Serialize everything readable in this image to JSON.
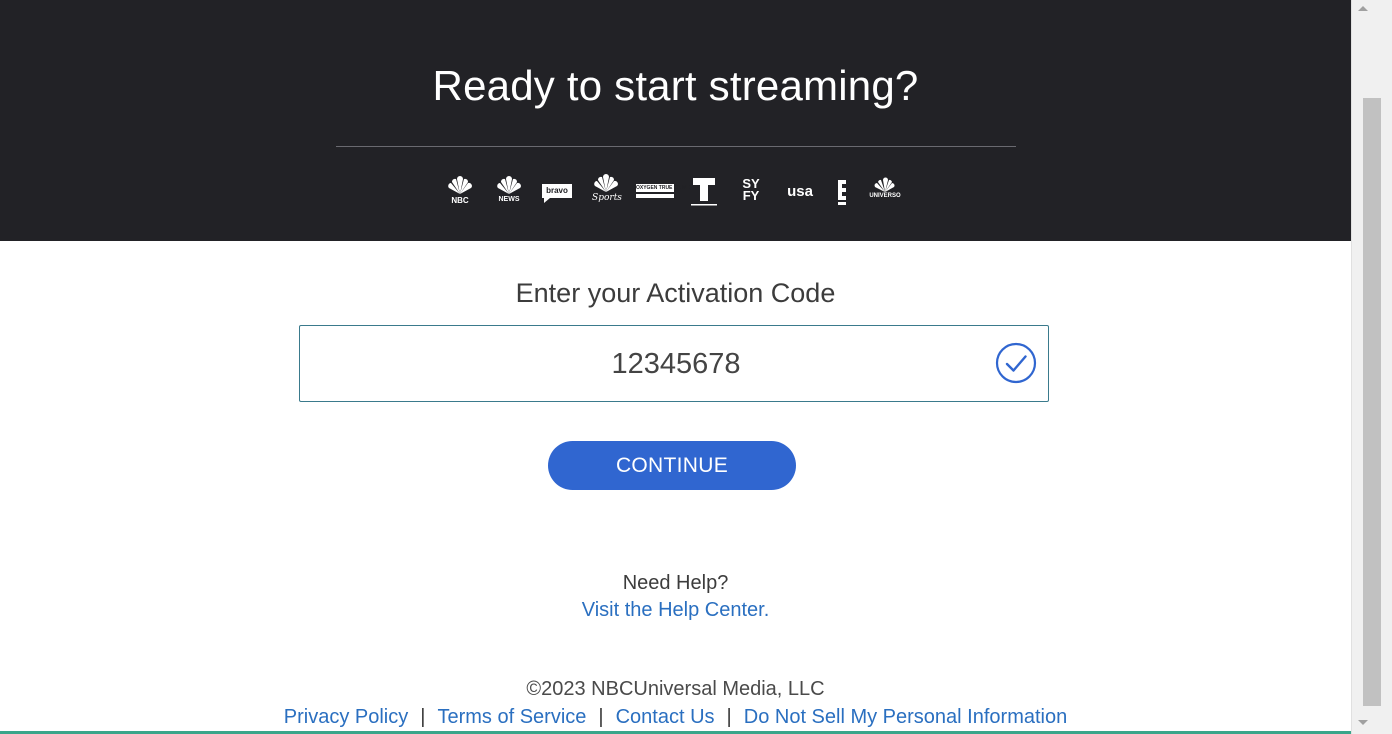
{
  "hero": {
    "title": "Ready to start streaming?",
    "network_logos": [
      {
        "name": "nbc-logo-icon",
        "label": "NBC"
      },
      {
        "name": "nbc-news-logo-icon",
        "label": "NEWS"
      },
      {
        "name": "bravo-logo-icon",
        "label": "bravo"
      },
      {
        "name": "nbc-sports-logo-icon",
        "label": "Sports"
      },
      {
        "name": "oxygen-logo-icon",
        "label": "OXYGEN TRUE CRIME"
      },
      {
        "name": "telemundo-logo-icon",
        "label": "T"
      },
      {
        "name": "syfy-logo-icon",
        "label": "SY FY"
      },
      {
        "name": "usa-logo-icon",
        "label": "usa"
      },
      {
        "name": "e-logo-icon",
        "label": "E"
      },
      {
        "name": "universo-logo-icon",
        "label": "UNIVERSO"
      }
    ]
  },
  "activation": {
    "heading": "Enter your Activation Code",
    "code_value": "12345678",
    "valid_icon": "check-circle-icon",
    "continue_label": "CONTINUE"
  },
  "help": {
    "question": "Need Help?",
    "link_label": "Visit the Help Center."
  },
  "footer": {
    "copyright": "©2023 NBCUniversal Media, LLC",
    "links": [
      "Privacy Policy",
      "Terms of Service",
      "Contact Us",
      "Do Not Sell My Personal Information"
    ],
    "separator": "|"
  },
  "colors": {
    "hero_background": "#222226",
    "button": "#3066d0",
    "link": "#2a6fc0",
    "input_border": "#3a7a8c"
  }
}
